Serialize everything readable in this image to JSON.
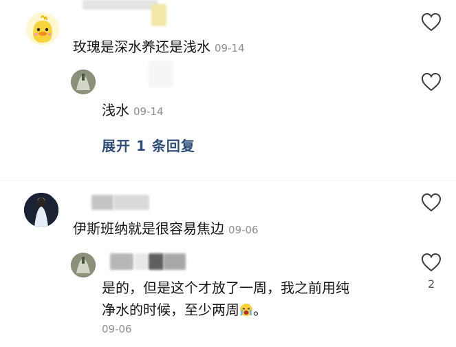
{
  "comments": [
    {
      "text": "玫瑰是深水养还是浅水",
      "time": "09-14",
      "replies": [
        {
          "text": "浅水",
          "time": "09-14"
        }
      ],
      "expand_label": "展开 1 条回复"
    },
    {
      "text": "伊斯班纳就是很容易焦边",
      "time": "09-06",
      "replies": [
        {
          "line1": "是的，但是这个才放了一周，我之前用纯",
          "line2": "净水的时候，至少两周",
          "line2_end": "。",
          "time": "09-06",
          "likes": "2"
        }
      ]
    }
  ],
  "icons": {
    "like": "heart-outline-icon",
    "reply_emoji": "crying-emoji-icon"
  },
  "colors": {
    "expand_link": "#2d4d78",
    "timestamp": "#8e8e93",
    "heart_stroke": "#3a3a3a"
  }
}
